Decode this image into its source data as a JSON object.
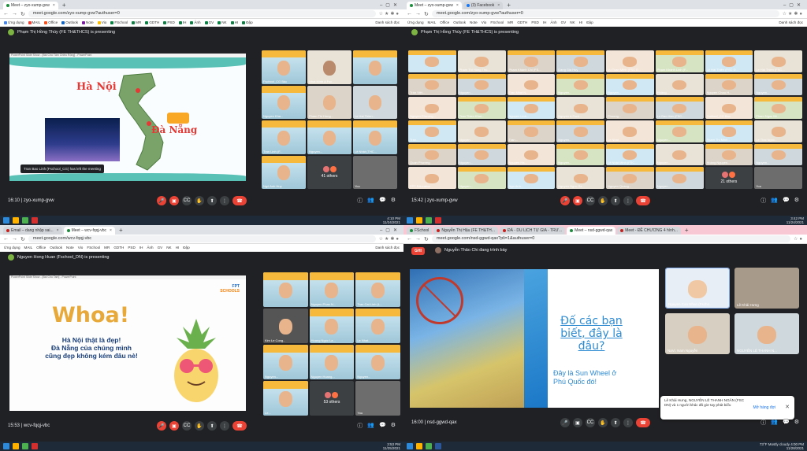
{
  "q1": {
    "tabs": [
      {
        "label": "Meet – zyo-xump-gvw",
        "color": "#1e8e3e"
      }
    ],
    "url": "meet.google.com/zyo-xump-gvw?authuser=0",
    "bookmarks": [
      "Ứng dụng",
      "MAIL",
      "Office",
      "Outlook",
      "Note",
      "Vio",
      "FSchool",
      "MR",
      "GDTH",
      "PSD",
      "IH",
      "Ảnh",
      "GV",
      "NK",
      "HI",
      "Đập"
    ],
    "bookmarks_right": "Danh sách đọc",
    "presenting": "Phạm Thị Hồng Thúy (FE TH&THCS) is presenting",
    "slide_strip": "PowerPoint Slide Show - [Bài Chú Tâm Chiều Rộng] - PowerPoint",
    "city1": "Hà Nội",
    "city2": "Đà Nẵng",
    "toast": "Tran Bao Linh (Fschool_CG) has left the meeting",
    "tiles": [
      {
        "name": "Fschool_CG Bảo"
      },
      {
        "name": "Nhat Minh A Fsc..."
      },
      {
        "name": ""
      },
      {
        "name": "Nguyen Kha..."
      },
      {
        "name": "Pham Thi Hong..."
      },
      {
        "name": "Le Hai Thien..."
      },
      {
        "name": "Tran Linh (F..."
      },
      {
        "name": "Nguyen..."
      },
      {
        "name": "Lê Nhật (THC..."
      },
      {
        "name": "Ngô Anh Huy"
      }
    ],
    "others": "41 others",
    "you": "You",
    "time": "16:10",
    "code": "zyo-xump-gvw",
    "clock_time": "4:10 PM",
    "clock_date": "11/24/2021"
  },
  "q2": {
    "tabs": [
      {
        "label": "Meet – zyo-xump-gvw",
        "color": "#1e8e3e"
      },
      {
        "label": "(3) Facebook",
        "color": "#1877f2"
      }
    ],
    "url": "meet.google.com/zyo-xump-gvw?authuser=0",
    "bookmarks": [
      "Ứng dụng",
      "MAIL",
      "Office",
      "Outlook",
      "Note",
      "Vio",
      "FSchool",
      "MR",
      "GDTH",
      "PSD",
      "IH",
      "Ảnh",
      "GV",
      "NK",
      "HI",
      "Đập"
    ],
    "bookmarks_right": "Danh sách đọc",
    "presenting": "Phạm Thị Hồng Thúy (FE TH&THCS) is presenting",
    "tiles": [
      "",
      "Pham Thi Hồng Thú...",
      "Phạm Khánh Chi (FS...",
      "Dang Gia Huy",
      "Vu Tuan Minh (FSC D...",
      "Phạm Khánh Linh (F...",
      "Lê Hải Thiên (FSC D...",
      "Le Hai Thien (FSC...",
      "Trần Việt...",
      "Nguyen...",
      "Tran Nhat N...",
      "Nguyen...",
      "Nguyen...",
      "Hoàng...",
      "Nguyen Chau H...",
      "Nguyen...",
      "Nguyen Phương...",
      "Tran Thien Khoi...",
      "Nguyen Linh...",
      "Nguyen A Fsch...",
      "Phuong...",
      "Le Bao Han (FSC...",
      "Fschool_CG Bao",
      "Pham Ngoc Mi...",
      "Tran...",
      "Nguyen...",
      "Tran...",
      "Nguyen...",
      "Le Nhat...",
      "Nguyen...",
      "Phạm Thị Minh...",
      "Le Thai Ngoc...",
      "Quan Phương",
      "Nguyen...",
      "Nguyen Ha...",
      "Nguyen...",
      "Lê Nhật Minh (FSC...",
      "Nguyen...",
      "Hoàng Nguyen...",
      "Nguyen...",
      "FPT Education",
      "Nguyen...",
      "Ngo Anh...",
      "Nguyen Ngoc Sa...",
      "Nguyen Quang...",
      "Nguyen...",
      "21 others",
      "You"
    ],
    "others": "21 others",
    "you": "You",
    "time": "15:42",
    "code": "zyo-xump-gvw",
    "clock_time": "3:42 PM",
    "clock_date": "11/24/2021"
  },
  "q3": {
    "tabs": [
      {
        "label": "Email – dang nhập sai...",
        "color": "#c5221f"
      },
      {
        "label": "Meet – wcv-fqqj-vbc",
        "color": "#1e8e3e"
      }
    ],
    "url": "meet.google.com/wcv-fqqj-vbc",
    "bookmarks": [
      "Ứng dụng",
      "MAIL",
      "Office",
      "Outlook",
      "Note",
      "Vio",
      "FSchool",
      "MR",
      "GDTH",
      "PSD",
      "IH",
      "Ảnh",
      "GV",
      "NK",
      "HI",
      "Đập"
    ],
    "bookmarks_right": "Danh sách đọc",
    "presenting": "Nguyen Hong Huan (Fschool_DN) is presenting",
    "slide_strip": "PowerPoint Slide Show - [Bai Chu Tam] - PowerPoint",
    "whoa": "Whoa!",
    "line1": "Hà Nội thật là đẹp!",
    "line2": "Đà Nẵng của chúng mình",
    "line3": "cũng đẹp không kém đâu nè!",
    "logo1": "FPT",
    "logo2": "SCHOOLS",
    "tiles": [
      {
        "name": ""
      },
      {
        "name": "Nguyen Phan N..."
      },
      {
        "name": "Tran Cat Linh (L..."
      },
      {
        "name": "Kim Le Cong..."
      },
      {
        "name": "Hoang Ngoc La..."
      },
      {
        "name": "Le Nhat..."
      },
      {
        "name": "Nguyen..."
      },
      {
        "name": "Nguyen Hoang..."
      },
      {
        "name": "Nguyen..."
      },
      {
        "name": "Le..."
      }
    ],
    "others": "53 others",
    "you": "You",
    "time": "15:53",
    "code": "wcv-fqqj-vbc",
    "clock_time": "3:53 PM",
    "clock_date": "11/25/2021"
  },
  "q4": {
    "tabs": [
      {
        "label": "FSchool",
        "color": "#1e8e3e"
      },
      {
        "label": "Nguyễn Thị Hậu (FE TH&TH...",
        "color": "#c5221f"
      },
      {
        "label": "ĐÀ - DU LỊCH TỰ GIA - TRƯ...",
        "color": "#c5221f"
      },
      {
        "label": "Meet – nsd-ggwd-qax",
        "color": "#1e8e3e"
      },
      {
        "label": "Meet - ĐỀ CHƯƠNG 4 hình...",
        "color": "#c5221f"
      }
    ],
    "url": "meet.google.com/nsd-ggwd-qax?pli=1&authuser=0",
    "ghi": "GHI",
    "presenting": "Nguyễn Thảo Chi đang trình bày",
    "title": "Đố các bạn biết, đây là đâu?",
    "sub": "Đây là Sun Wheel ở Phú Quốc đó!",
    "tiles": [
      "Nguyen Cao Nhan (Fscho...",
      "Lê Khải Hưng",
      "NaVi. Nam Nguyễn",
      "NGUYỄN LÊ THANH N..."
    ],
    "notify_text": "Lê Khải Hưng, NGUYỄN LÊ THANH NGÂN (FSC DN) và 1 người khác đã giơ tay phát biểu",
    "notify_action": "Mở hàng đợi",
    "time": "16:00",
    "code": "nsd-ggwd-qax",
    "weather": "73°F  Mostly cloudy",
    "clock_time": "4:00 PM",
    "clock_date": "11/28/2021"
  }
}
